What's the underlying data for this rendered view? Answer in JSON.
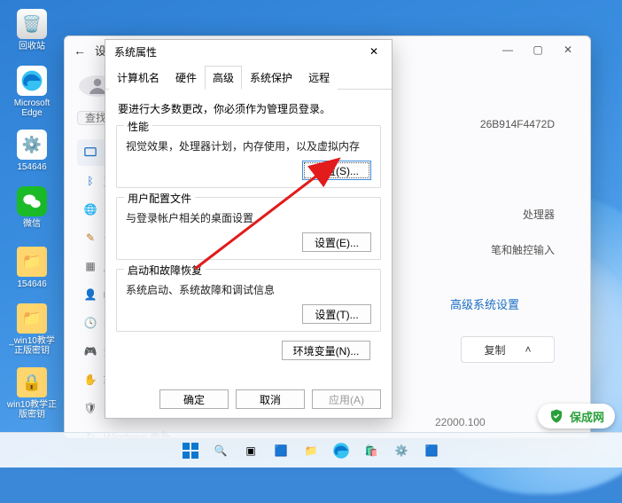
{
  "desktop_icons": {
    "recycle": "回收站",
    "edge": "Microsoft Edge",
    "gear": "154646",
    "wechat": "微信",
    "folder1": "154646",
    "folder2": "_win10教学正版密钥",
    "lock": "win10教学正版密钥"
  },
  "settings": {
    "title": "设置",
    "search_placeholder": "查找设置",
    "nav": {
      "system": "系统",
      "bt": "蓝牙",
      "net": "网络",
      "pers": "个性",
      "apps": "应用",
      "acct": "帐户",
      "time": "时间",
      "game": "游戏",
      "access": "辅助",
      "privacy": "隐私",
      "update": "Windows 更新"
    },
    "device_id_tail": "26B914F4472D",
    "cpu_label": "处理器",
    "pen_label": "笔和触控输入",
    "adv_link": "高级系统设置",
    "copy": "复制",
    "build": "22000.100"
  },
  "dlg": {
    "title": "系统属性",
    "tabs": {
      "name": "计算机名",
      "hw": "硬件",
      "adv": "高级",
      "prot": "系统保护",
      "remote": "远程"
    },
    "hint": "要进行大多数更改，你必须作为管理员登录。",
    "perf": {
      "title": "性能",
      "desc": "视觉效果，处理器计划，内存使用，以及虚拟内存",
      "btn": "设置(S)..."
    },
    "prof": {
      "title": "用户配置文件",
      "desc": "与登录帐户相关的桌面设置",
      "btn": "设置(E)..."
    },
    "boot": {
      "title": "启动和故障恢复",
      "desc": "系统启动、系统故障和调试信息",
      "btn": "设置(T)..."
    },
    "env": "环境变量(N)...",
    "ok": "确定",
    "cancel": "取消",
    "apply": "应用(A)"
  },
  "watermark": "保成网"
}
